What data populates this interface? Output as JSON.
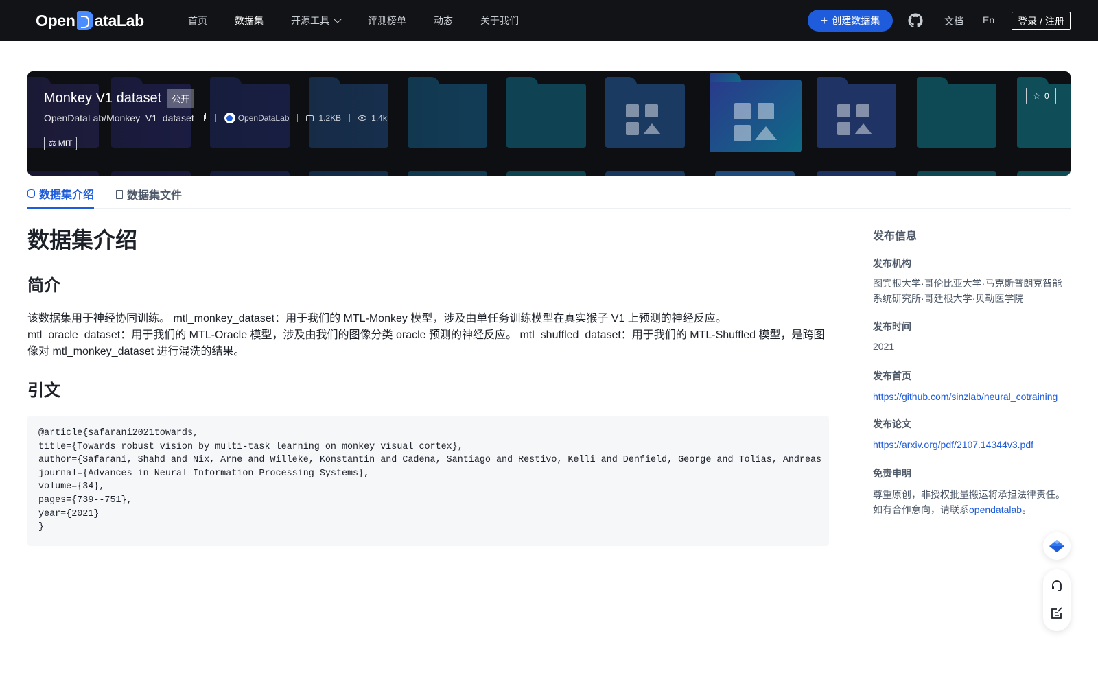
{
  "nav": {
    "logo_text_before": "Open",
    "logo_text_after": "ataLab",
    "links": [
      {
        "label": "首页",
        "active": false
      },
      {
        "label": "数据集",
        "active": true
      },
      {
        "label": "开源工具",
        "active": false,
        "dropdown": true
      },
      {
        "label": "评测榜单",
        "active": false
      },
      {
        "label": "动态",
        "active": false
      },
      {
        "label": "关于我们",
        "active": false
      }
    ],
    "create_button": "创建数据集",
    "github_icon": "github-icon",
    "docs": "文档",
    "language": "En",
    "login": "登录 / 注册"
  },
  "banner": {
    "title": "Monkey V1 dataset",
    "visibility": "公开",
    "repo_path": "OpenDataLab/Monkey_V1_dataset",
    "org": "OpenDataLab",
    "size": "1.2KB",
    "views": "1.4k",
    "license": "MIT",
    "stars": "0"
  },
  "tabs": [
    {
      "label": "数据集介绍",
      "active": true
    },
    {
      "label": "数据集文件",
      "active": false
    }
  ],
  "main": {
    "heading": "数据集介绍",
    "intro_heading": "简介",
    "intro_text": "该数据集用于神经协同训练。 mtl_monkey_dataset：用于我们的 MTL-Monkey 模型，涉及由单任务训练模型在真实猴子 V1 上预测的神经反应。 mtl_oracle_dataset：用于我们的 MTL-Oracle 模型，涉及由我们的图像分类 oracle 预测的神经反应。 mtl_shuffled_dataset：用于我们的 MTL-Shuffled 模型，是跨图像对 mtl_monkey_dataset 进行混洗的结果。",
    "citation_heading": "引文",
    "citation_code": "@article{safarani2021towards,\ntitle={Towards robust vision by multi-task learning on monkey visual cortex},\nauthor={Safarani, Shahd and Nix, Arne and Willeke, Konstantin and Cadena, Santiago and Restivo, Kelli and Denfield, George and Tolias, Andreas\njournal={Advances in Neural Information Processing Systems},\nvolume={34},\npages={739--751},\nyear={2021}\n}"
  },
  "sidebar": {
    "title": "发布信息",
    "org_label": "发布机构",
    "org_value": "图宾根大学·哥伦比亚大学·马克斯普朗克智能系统研究所·哥廷根大学·贝勒医学院",
    "time_label": "发布时间",
    "time_value": "2021",
    "home_label": "发布首页",
    "home_value": "https://github.com/sinzlab/neural_cotraining",
    "paper_label": "发布论文",
    "paper_value": "https://arxiv.org/pdf/2107.14344v3.pdf",
    "disclaimer_label": "免责申明",
    "disclaimer_line1": "尊重原创，非授权批量搬运将承担法律责任。",
    "disclaimer_line2_pre": "如有合作意向，请联系",
    "disclaimer_link": "opendatalab",
    "disclaimer_line2_post": "。"
  },
  "floating": {
    "top_icon": "diamond-icon",
    "support_icon": "headset-icon",
    "feedback_icon": "feedback-icon"
  },
  "colors": {
    "primary": "#1f5cdb",
    "nav_bg": "#121316",
    "banner_bg": "#0e0f12"
  }
}
